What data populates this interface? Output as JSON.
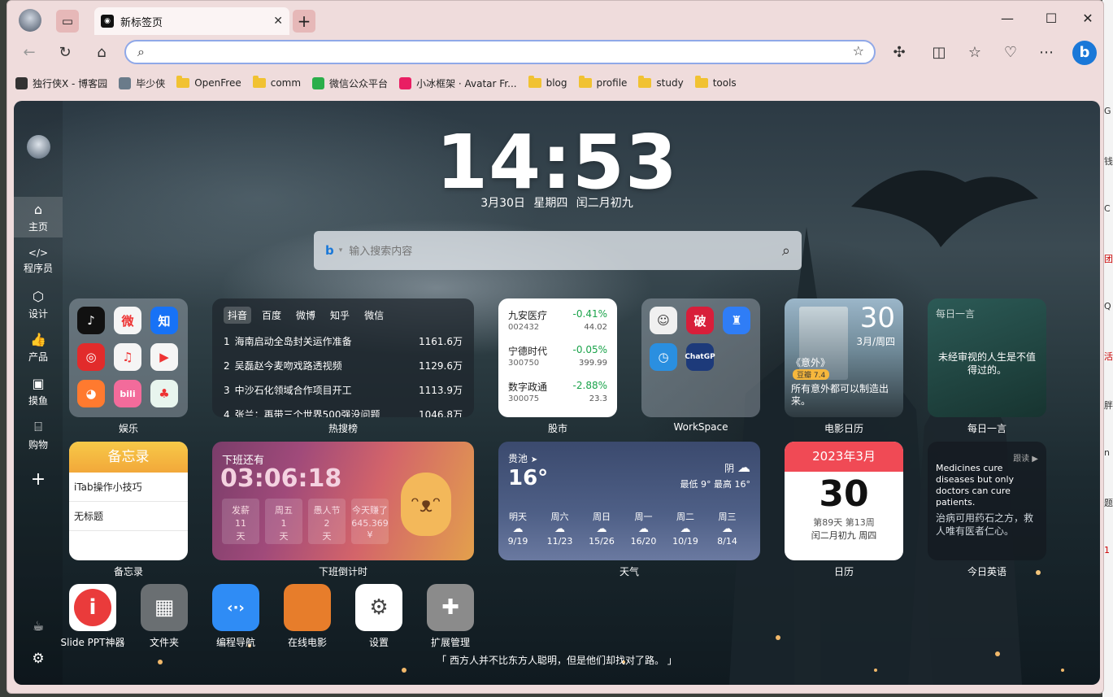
{
  "tab": {
    "title": "新标签页"
  },
  "address": {
    "value": ""
  },
  "bookmarks": [
    {
      "label": "独行侠X - 博客园",
      "icon": "blog-icon"
    },
    {
      "label": "毕少侠",
      "icon": "avatar-icon"
    },
    {
      "label": "OpenFree",
      "icon": "folder-icon"
    },
    {
      "label": "comm",
      "icon": "folder-icon"
    },
    {
      "label": "微信公众平台",
      "icon": "wechat-icon"
    },
    {
      "label": "小冰框架 · Avatar Fr...",
      "icon": "xiaobing-icon"
    },
    {
      "label": "blog",
      "icon": "folder-icon"
    },
    {
      "label": "profile",
      "icon": "folder-icon"
    },
    {
      "label": "study",
      "icon": "folder-icon"
    },
    {
      "label": "tools",
      "icon": "folder-icon"
    }
  ],
  "sidebar": {
    "items": [
      {
        "label": "主页",
        "icon": "home-icon"
      },
      {
        "label": "程序员",
        "icon": "code-icon"
      },
      {
        "label": "设计",
        "icon": "cube-icon"
      },
      {
        "label": "产品",
        "icon": "thumb-icon"
      },
      {
        "label": "摸鱼",
        "icon": "gamepad-icon"
      },
      {
        "label": "购物",
        "icon": "bag-icon"
      }
    ]
  },
  "clock": {
    "time": "14:53",
    "date": "3月30日 星期四 闰二月初九"
  },
  "search": {
    "placeholder": "输入搜索内容"
  },
  "widgets": {
    "entertainment": {
      "label": "娱乐",
      "apps": [
        {
          "name": "tiktok",
          "text": "♪",
          "color": "#111111"
        },
        {
          "name": "weibo",
          "text": "微",
          "color": "#f5f5f5"
        },
        {
          "name": "zhihu",
          "text": "知",
          "color": "#1772f6"
        },
        {
          "name": "netease-music",
          "text": "◎",
          "color": "#e22b2b"
        },
        {
          "name": "qq-music",
          "text": "♫",
          "color": "#f5f5f5"
        },
        {
          "name": "youku",
          "text": "▶",
          "color": "#f5f5f5"
        },
        {
          "name": "duck",
          "text": "◕",
          "color": "#ff7a2f"
        },
        {
          "name": "bilibili",
          "text": "bili",
          "color": "#f36b9b"
        },
        {
          "name": "app9",
          "text": "♣",
          "color": "#e8f5ee"
        }
      ]
    },
    "hotsearch": {
      "label": "热搜榜",
      "tabs": [
        "抖音",
        "百度",
        "微博",
        "知乎",
        "微信"
      ],
      "items": [
        {
          "rank": "1",
          "title": "海南启动全岛封关运作准备",
          "value": "1161.6万"
        },
        {
          "rank": "2",
          "title": "吴磊赵今麦吻戏路透视频",
          "value": "1129.6万"
        },
        {
          "rank": "3",
          "title": "中沙石化领域合作项目开工",
          "value": "1113.9万"
        },
        {
          "rank": "4",
          "title": "张兰：再带三个世界500强没问题",
          "value": "1046.8万"
        }
      ]
    },
    "stocks": {
      "label": "股市",
      "items": [
        {
          "name": "九安医疗",
          "code": "002432",
          "pct": "-0.41%",
          "price": "44.02"
        },
        {
          "name": "宁德时代",
          "code": "300750",
          "pct": "-0.05%",
          "price": "399.99"
        },
        {
          "name": "数字政通",
          "code": "300075",
          "pct": "-2.88%",
          "price": "23.3"
        }
      ]
    },
    "workspace": {
      "label": "WorkSpace",
      "apps": [
        {
          "name": "avatar",
          "text": "☺",
          "color": "#f0f0f0"
        },
        {
          "name": "red-app",
          "text": "破",
          "color": "#d81e3a"
        },
        {
          "name": "bird-app",
          "text": "♜",
          "color": "#2f7df6"
        },
        {
          "name": "clock-app",
          "text": "◷",
          "color": "#2a8fe0"
        },
        {
          "name": "chatgpt-app",
          "text": "ChatGP",
          "color": "#1d3a7a"
        }
      ]
    },
    "movie": {
      "label": "电影日历",
      "day": "30",
      "month_week": "3月/周四",
      "title": "《意外》",
      "rating": "豆瓣 7.4",
      "quote": "所有意外都可以制造出来。"
    },
    "daily": {
      "label": "每日一言",
      "header": "每日一言",
      "text": "未经审视的人生是不值得过的。"
    },
    "memo": {
      "label": "备忘录",
      "header": "备忘录",
      "items": [
        "iTab操作小技巧",
        "无标题"
      ]
    },
    "offwork": {
      "label": "下班倒计时",
      "title": "下班还有",
      "countdown": "03:06:18",
      "cells": [
        {
          "title": "发薪",
          "value": "11",
          "unit": "天"
        },
        {
          "title": "周五",
          "value": "1",
          "unit": "天"
        },
        {
          "title": "愚人节",
          "value": "2",
          "unit": "天"
        },
        {
          "title": "今天赚了",
          "value": "645.369",
          "unit": "¥"
        }
      ]
    },
    "weather": {
      "label": "天气",
      "city": "贵池",
      "temp": "16°",
      "cond": "阴",
      "range": "最低 9° 最高 16°",
      "days": [
        {
          "day": "明天",
          "temp": "9/19"
        },
        {
          "day": "周六",
          "temp": "11/23"
        },
        {
          "day": "周日",
          "temp": "15/26"
        },
        {
          "day": "周一",
          "temp": "16/20"
        },
        {
          "day": "周二",
          "temp": "10/19"
        },
        {
          "day": "周三",
          "temp": "8/14"
        }
      ]
    },
    "calendar": {
      "label": "日历",
      "header": "2023年3月",
      "day": "30",
      "sub1": "第89天 第13周",
      "sub2": "闰二月初九 周四"
    },
    "english": {
      "label": "今日英语",
      "follow": "跟读 ▶",
      "en": "Medicines cure diseases but only doctors can cure patients.",
      "zh": "治病可用药石之方，救人唯有医者仁心。"
    }
  },
  "dock": [
    {
      "label": "Slide PPT神器",
      "icon": "slide-ppt-icon",
      "color": "#ffffff"
    },
    {
      "label": "文件夹",
      "icon": "folder-app-icon",
      "color": "#6a6f72"
    },
    {
      "label": "编程导航",
      "icon": "code-nav-icon",
      "color": "#2f8cf5"
    },
    {
      "label": "在线电影",
      "icon": "movie-icon",
      "color": "#e77d2b"
    },
    {
      "label": "设置",
      "icon": "settings-icon",
      "color": "#ffffff"
    },
    {
      "label": "扩展管理",
      "icon": "extension-icon",
      "color": "#8b8b8b"
    }
  ],
  "quote": "「 西方人并不比东方人聪明，但是他们却找对了路。 」"
}
